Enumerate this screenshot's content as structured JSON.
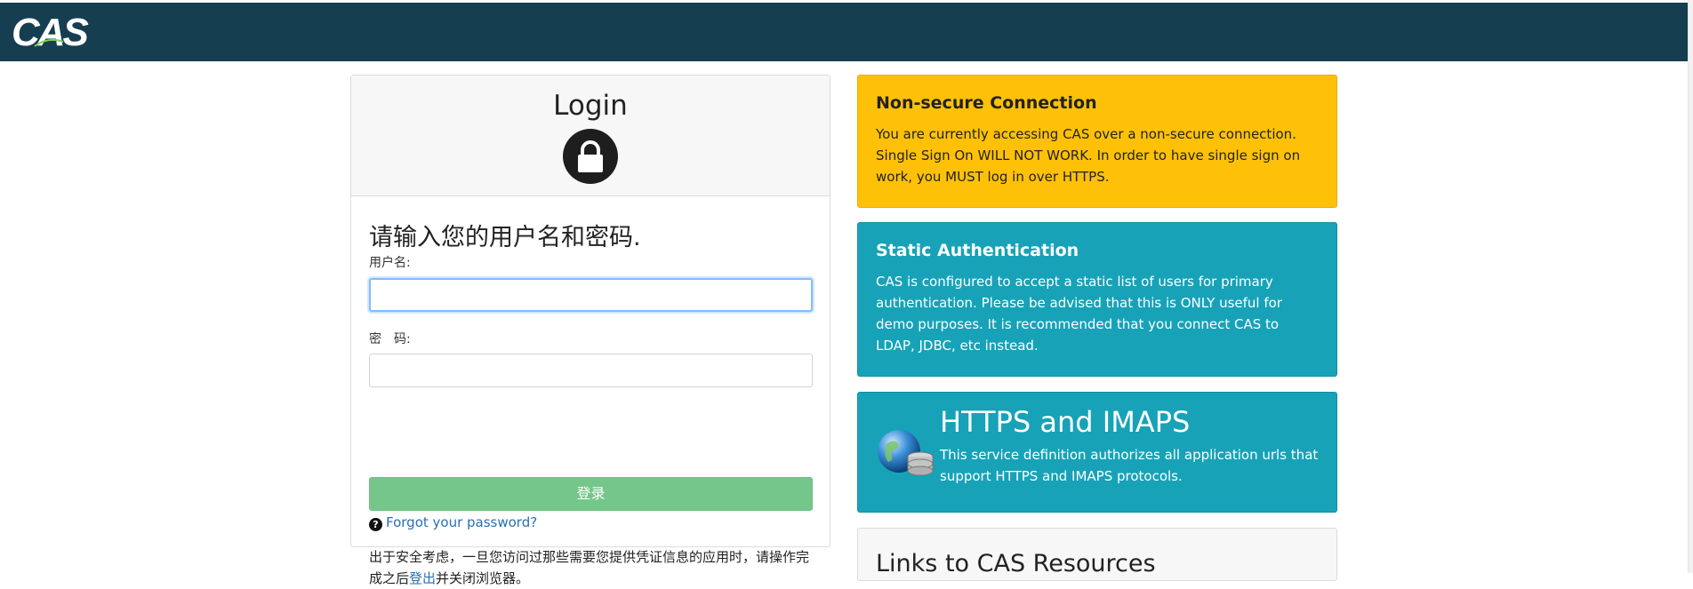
{
  "header": {
    "logo_text": "CAS",
    "bar_color": "#153e50"
  },
  "login": {
    "title": "Login",
    "lock_icon": "lock-icon",
    "prompt": "请输入您的用户名和密码.",
    "username_label": "用户名:",
    "username_value": "",
    "password_label": "密　码:",
    "password_value": "",
    "submit_label": "登录",
    "submit_color": "#75c68a",
    "forgot_icon": "question-circle-icon",
    "forgot_label": "Forgot your password?",
    "security_note_before": "出于安全考虑，一旦您访问过那些需要您提供凭证信息的应用时，请操作完成之后",
    "security_note_link": "登出",
    "security_note_after": "并关闭浏览器。"
  },
  "notices": {
    "nonsecure": {
      "title": "Non-secure Connection",
      "text": "You are currently accessing CAS over a non-secure connection. Single Sign On WILL NOT WORK. In order to have single sign on work, you MUST log in over HTTPS.",
      "color": "#ffc107"
    },
    "static_auth": {
      "title": "Static Authentication",
      "text": "CAS is configured to accept a static list of users for primary authentication. Please be advised that this is ONLY useful for demo purposes. It is recommended that you connect CAS to LDAP, JDBC, etc instead.",
      "color": "#17a2b8"
    },
    "service": {
      "icon": "globe-database-icon",
      "title": "HTTPS and IMAPS",
      "text": "This service definition authorizes all application urls that support HTTPS and IMAPS protocols.",
      "color": "#17a2b8"
    },
    "links": {
      "title": "Links to CAS Resources"
    }
  }
}
